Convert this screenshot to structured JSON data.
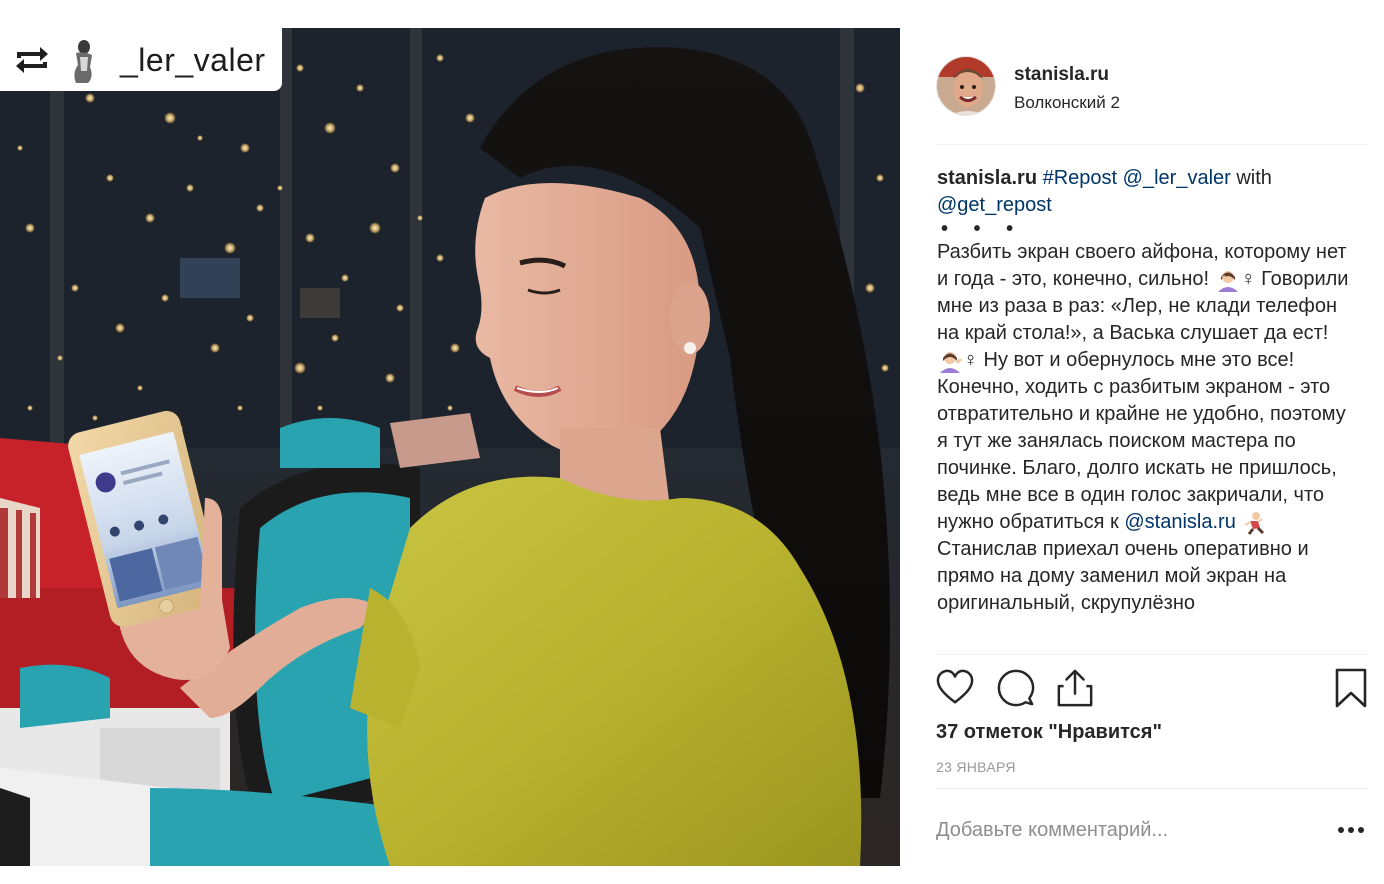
{
  "repost": {
    "username": "_ler_valer"
  },
  "header": {
    "username": "stanisla.ru",
    "location": "Волконский 2"
  },
  "caption": {
    "author": "stanisla.ru",
    "hashtag": "#Repost",
    "mention_ler": "@_ler_valer",
    "with_word": " with",
    "mention_get_repost": "@get_repost",
    "dots": "• • •",
    "text1": "Разбить экран своего айфона, которому нет и года - это, конечно, сильно! ",
    "female_sign_1": "♀",
    "text2": " Говорили мне из раза в раз: «Лер, не клади телефон на край стола!», а Васька слушает да ест! ",
    "female_sign_2": "♀",
    "text3": " Ну вот и обернулось мне это все!",
    "text4": "Конечно, ходить с разбитым экраном - это отвратительно и крайне не удобно, поэтому я тут же занялась поиском мастера по починке. Благо, долго искать не пришлось, ведь мне все в один голос закричали, что нужно обратиться к ",
    "mention_stanisla": "@stanisla.ru",
    "text5": " Станислав приехал очень оперативно и прямо на дому заменил мой экран на оригинальный, скрупулёзно"
  },
  "likes_text": "37 отметок \"Нравится\"",
  "date_text": "23 ЯНВАРЯ",
  "comment": {
    "placeholder": "Добавьте комментарий...",
    "value": ""
  },
  "icons": {
    "like": "heart-icon",
    "comment": "comment-icon",
    "share": "share-icon",
    "save": "bookmark-icon",
    "more": "more-dots-icon",
    "repost": "repost-icon"
  },
  "colors": {
    "link": "#003569",
    "text": "#262626",
    "muted": "#999999",
    "placeholder": "#8e8e8e",
    "divider": "#efefef"
  }
}
